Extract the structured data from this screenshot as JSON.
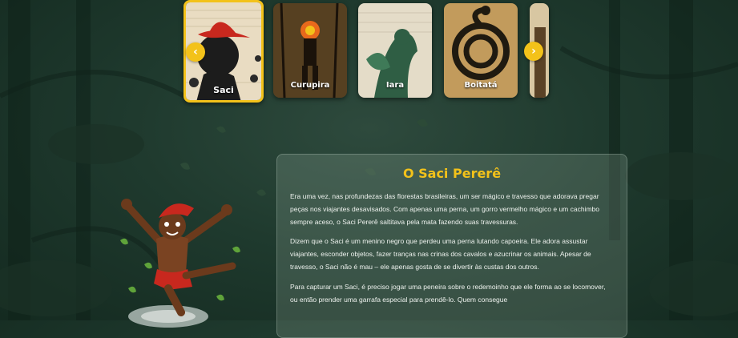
{
  "carousel": {
    "prev_icon": "chevron-left-icon",
    "next_icon": "chevron-right-icon",
    "accent": "#f3c21a",
    "cards": [
      {
        "label": "Saci",
        "active": true
      },
      {
        "label": "Curupira",
        "active": false
      },
      {
        "label": "Iara",
        "active": false
      },
      {
        "label": "Boitatá",
        "active": false
      },
      {
        "label": "",
        "active": false
      }
    ]
  },
  "story": {
    "title": "O Saci Pererê",
    "paragraphs": [
      "Era uma vez, nas profundezas das florestas brasileiras, um ser mágico e travesso que adorava pregar peças nos viajantes desavisados. Com apenas uma perna, um gorro vermelho mágico e um cachimbo sempre aceso, o Saci Pererê saltitava pela mata fazendo suas travessuras.",
      "Dizem que o Saci é um menino negro que perdeu uma perna lutando capoeira. Ele adora assustar viajantes, esconder objetos, fazer tranças nas crinas dos cavalos e azucrinar os animais. Apesar de travesso, o Saci não é mau – ele apenas gosta de se divertir às custas dos outros.",
      "Para capturar um Saci, é preciso jogar uma peneira sobre o redemoinho que ele forma ao se locomover, ou então prender uma garrafa especial para prendê-lo. Quem consegue"
    ]
  }
}
